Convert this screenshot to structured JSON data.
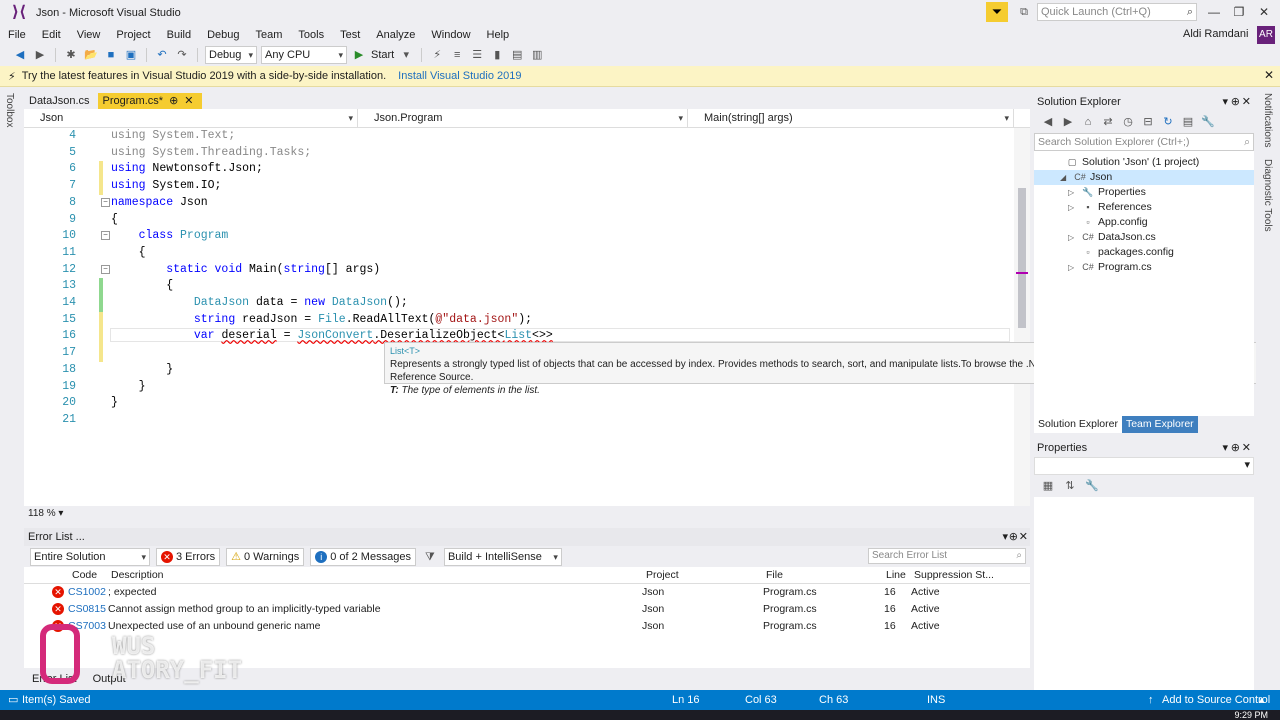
{
  "window": {
    "title": "Json - Microsoft Visual Studio",
    "quick_launch_placeholder": "Quick Launch (Ctrl+Q)",
    "user_name": "Aldi Ramdani",
    "user_initials": "AR"
  },
  "menu": [
    "File",
    "Edit",
    "View",
    "Project",
    "Build",
    "Debug",
    "Team",
    "Tools",
    "Test",
    "Analyze",
    "Window",
    "Help"
  ],
  "toolbar": {
    "config": "Debug",
    "platform": "Any CPU",
    "start_label": "Start"
  },
  "infobar": {
    "message": "Try the latest features in Visual Studio 2019 with a side-by-side installation.",
    "link": "Install Visual Studio 2019"
  },
  "left_strip": {
    "toolbox_label": "Toolbox"
  },
  "tabs": [
    {
      "label": "DataJson.cs"
    },
    {
      "label": "Program.cs*",
      "pin": "⊕",
      "close": "✕"
    }
  ],
  "navbar": {
    "project": "Json",
    "class": "Json.Program",
    "member": "Main(string[] args)"
  },
  "code_lines": [
    {
      "n": "4",
      "parts": [
        {
          "t": "using System.Text;",
          "c": "gray"
        }
      ]
    },
    {
      "n": "5",
      "parts": [
        {
          "t": "using System.Threading.Tasks;",
          "c": "gray"
        }
      ]
    },
    {
      "n": "6",
      "parts": [
        {
          "t": "using ",
          "c": "kw"
        },
        {
          "t": "Newtonsoft.Json;",
          "c": ""
        }
      ]
    },
    {
      "n": "7",
      "parts": [
        {
          "t": "using ",
          "c": "kw"
        },
        {
          "t": "System.IO;",
          "c": ""
        }
      ]
    },
    {
      "n": "8",
      "parts": [
        {
          "t": "namespace ",
          "c": "kw"
        },
        {
          "t": "Json",
          "c": ""
        }
      ]
    },
    {
      "n": "9",
      "parts": [
        {
          "t": "{",
          "c": ""
        }
      ]
    },
    {
      "n": "10",
      "parts": [
        {
          "t": "    class ",
          "c": "kw"
        },
        {
          "t": "Program",
          "c": "ty"
        }
      ]
    },
    {
      "n": "11",
      "parts": [
        {
          "t": "    {",
          "c": ""
        }
      ]
    },
    {
      "n": "12",
      "parts": [
        {
          "t": "        static void ",
          "c": "kw"
        },
        {
          "t": "Main(",
          "c": ""
        },
        {
          "t": "string",
          "c": "kw"
        },
        {
          "t": "[] args)",
          "c": ""
        }
      ]
    },
    {
      "n": "13",
      "parts": [
        {
          "t": "        {",
          "c": ""
        }
      ]
    },
    {
      "n": "14",
      "parts": [
        {
          "t": "            ",
          "c": ""
        },
        {
          "t": "DataJson",
          "c": "ty"
        },
        {
          "t": " data = ",
          "c": ""
        },
        {
          "t": "new ",
          "c": "kw"
        },
        {
          "t": "DataJson",
          "c": "ty"
        },
        {
          "t": "();",
          "c": ""
        }
      ]
    },
    {
      "n": "15",
      "parts": [
        {
          "t": "            ",
          "c": ""
        },
        {
          "t": "string",
          "c": "kw"
        },
        {
          "t": " readJson = ",
          "c": ""
        },
        {
          "t": "File",
          "c": "ty"
        },
        {
          "t": ".ReadAllText(",
          "c": ""
        },
        {
          "t": "@\"data.json\"",
          "c": "str"
        },
        {
          "t": ");",
          "c": ""
        }
      ]
    },
    {
      "n": "16",
      "parts": [
        {
          "t": "            ",
          "c": ""
        },
        {
          "t": "var",
          "c": "kw"
        },
        {
          "t": " ",
          "c": ""
        },
        {
          "t": "deserial",
          "c": "sq"
        },
        {
          "t": " = ",
          "c": ""
        },
        {
          "t": "JsonConvert",
          "c": "ty sq"
        },
        {
          "t": ".DeserializeObject<",
          "c": "sq"
        },
        {
          "t": "List",
          "c": "ty sq"
        },
        {
          "t": "<>>",
          "c": "sq"
        }
      ]
    },
    {
      "n": "17",
      "parts": [
        {
          "t": "",
          "c": ""
        }
      ]
    },
    {
      "n": "18",
      "parts": [
        {
          "t": "        }",
          "c": ""
        }
      ]
    },
    {
      "n": "19",
      "parts": [
        {
          "t": "    }",
          "c": ""
        }
      ]
    },
    {
      "n": "20",
      "parts": [
        {
          "t": "}",
          "c": ""
        }
      ]
    },
    {
      "n": "21",
      "parts": [
        {
          "t": "",
          "c": ""
        }
      ]
    }
  ],
  "tooltip": {
    "type": "List<T>",
    "description": "Represents a strongly typed list of objects that can be accessed by index. Provides methods to search, sort, and manipulate lists.To browse the .NET Framework source code for this type, see the Reference Source.",
    "param_name": "T:",
    "param_desc": " The type of elements in the list."
  },
  "zoom": "118 %",
  "error_list": {
    "title": "Error List ...",
    "scope": "Entire Solution",
    "errors_label": "3 Errors",
    "warnings_label": "0 Warnings",
    "messages_label": "0 of 2 Messages",
    "build_filter": "Build + IntelliSense",
    "search_placeholder": "Search Error List",
    "columns": {
      "code": "Code",
      "description": "Description",
      "project": "Project",
      "file": "File",
      "line": "Line",
      "suppression": "Suppression St..."
    },
    "rows": [
      {
        "code": "CS1002",
        "description": "; expected",
        "project": "Json",
        "file": "Program.cs",
        "line": "16",
        "suppression": "Active"
      },
      {
        "code": "CS0815",
        "description": "Cannot assign method group to an implicitly-typed variable",
        "project": "Json",
        "file": "Program.cs",
        "line": "16",
        "suppression": "Active"
      },
      {
        "code": "CS7003",
        "description": "Unexpected use of an unbound generic name",
        "project": "Json",
        "file": "Program.cs",
        "line": "16",
        "suppression": "Active"
      }
    ]
  },
  "bottom_tabs": [
    "Error List",
    "Output"
  ],
  "watermark_text": "WUS\nATORY_FIT",
  "solution_explorer": {
    "title": "Solution Explorer",
    "search_placeholder": "Search Solution Explorer (Ctrl+;)",
    "items": [
      {
        "label": "Solution 'Json' (1 project)",
        "indent": 0,
        "icon": "▢",
        "arrow": ""
      },
      {
        "label": "Json",
        "indent": 1,
        "icon": "C#",
        "arrow": "◢",
        "selected": true
      },
      {
        "label": "Properties",
        "indent": 2,
        "icon": "🔧",
        "arrow": "▷"
      },
      {
        "label": "References",
        "indent": 2,
        "icon": "▪",
        "arrow": "▷"
      },
      {
        "label": "App.config",
        "indent": 2,
        "icon": "▫",
        "arrow": ""
      },
      {
        "label": "DataJson.cs",
        "indent": 2,
        "icon": "C#",
        "arrow": "▷"
      },
      {
        "label": "packages.config",
        "indent": 2,
        "icon": "▫",
        "arrow": ""
      },
      {
        "label": "Program.cs",
        "indent": 2,
        "icon": "C#",
        "arrow": "▷"
      }
    ],
    "tabs": [
      "Solution Explorer",
      "Team Explorer"
    ]
  },
  "properties": {
    "title": "Properties"
  },
  "right_strip": {
    "notifications": "Notifications",
    "diagnostic": "Diagnostic Tools"
  },
  "status": {
    "message": "Item(s) Saved",
    "ln": "Ln 16",
    "col": "Col 63",
    "ch": "Ch 63",
    "mode": "INS",
    "source_control": "Add to Source Control"
  },
  "clock": "9:29 PM",
  "colors": {
    "accent": "#007acc",
    "tab_active": "#f5cc30",
    "error": "#e51400"
  }
}
